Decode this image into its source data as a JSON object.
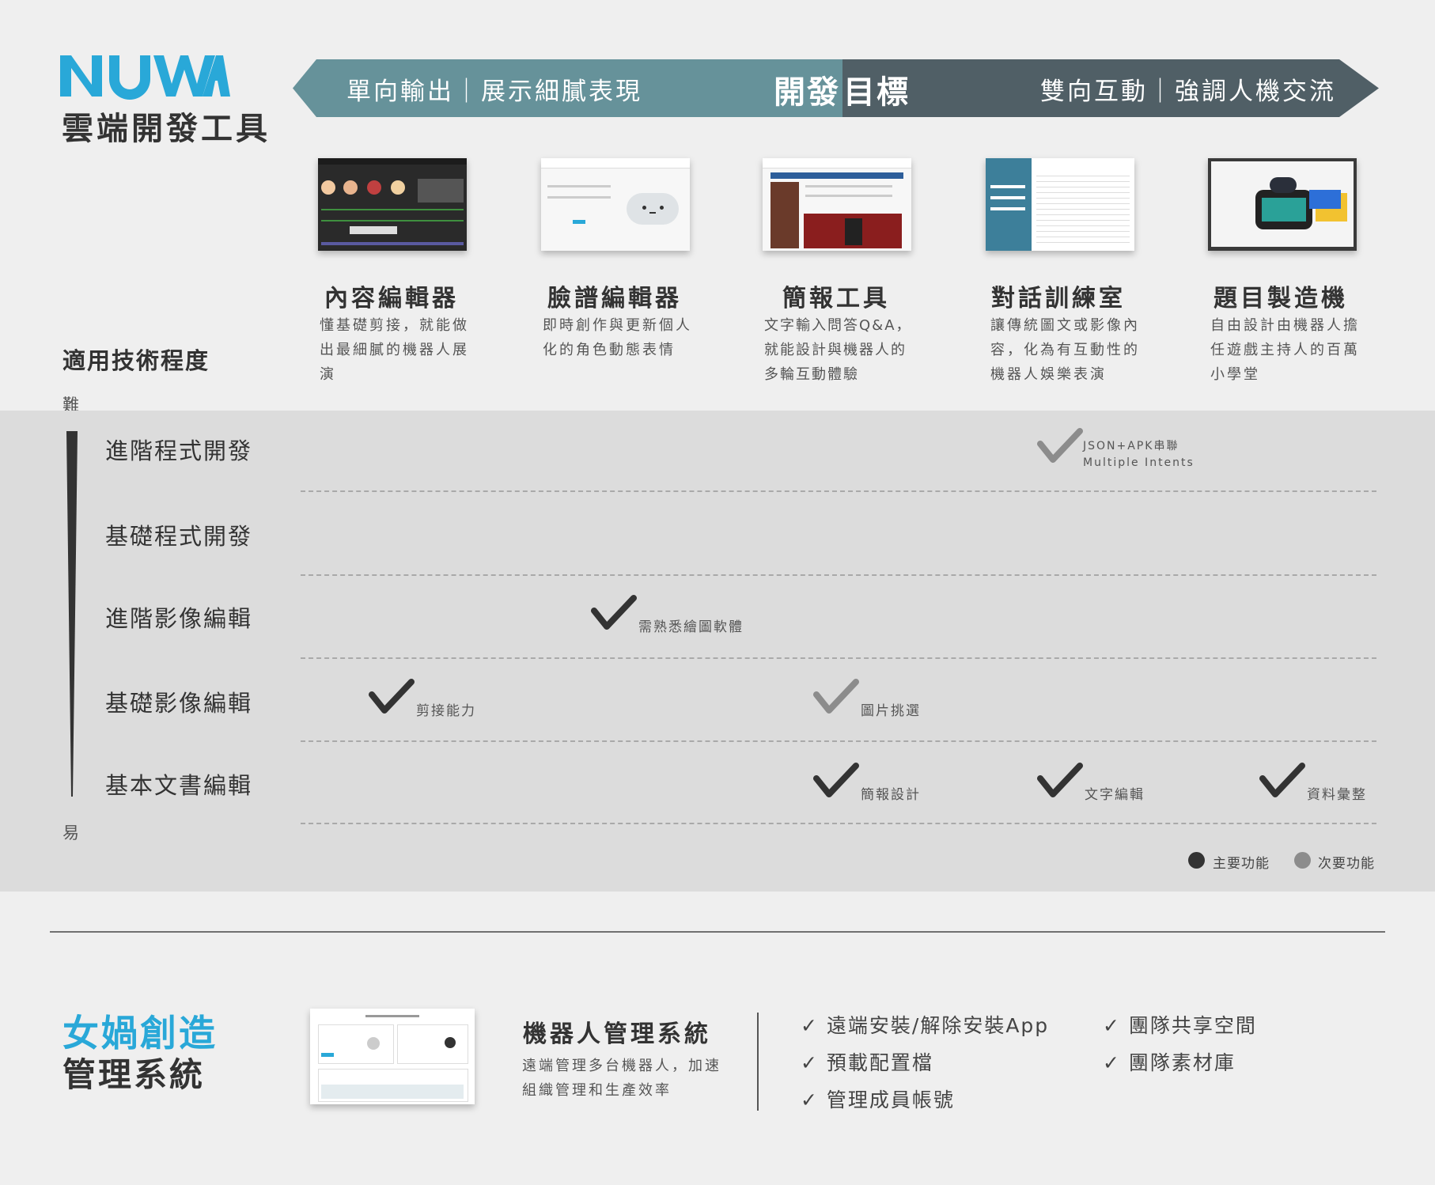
{
  "brand": {
    "logo": "NUWA",
    "subtitle": "雲端開發工具"
  },
  "goal_arrow": {
    "left_text": "單向輸出｜展示細膩表現",
    "center_left": "開發",
    "center_right": "目標",
    "right_text": "雙向互動｜強調人機交流"
  },
  "tools": [
    {
      "name": "內容編輯器",
      "desc": "懂基礎剪接，就能做出最細膩的機器人展演"
    },
    {
      "name": "臉譜編輯器",
      "desc": "即時創作與更新個人化的角色動態表情"
    },
    {
      "name": "簡報工具",
      "desc": "文字輸入問答Q&A，就能設計與機器人的多輪互動體驗"
    },
    {
      "name": "對話訓練室",
      "desc": "讓傳統圖文或影像內容，化為有互動性的機器人娛樂表演"
    },
    {
      "name": "題目製造機",
      "desc": "自由設計由機器人擔任遊戲主持人的百萬小學堂"
    }
  ],
  "level": {
    "title": "適用技術程度",
    "hard": "難",
    "easy": "易"
  },
  "rows": [
    "進階程式開發",
    "基礎程式開發",
    "進階影像編輯",
    "基礎影像編輯",
    "基本文書編輯"
  ],
  "marks": [
    {
      "row": 0,
      "tool": 3,
      "type": "secondary",
      "note_line1": "JSON+APK串聯",
      "note_line2": "Multiple Intents"
    },
    {
      "row": 2,
      "tool": 1,
      "type": "primary",
      "note": "需熟悉繪圖軟體"
    },
    {
      "row": 3,
      "tool": 0,
      "type": "primary",
      "note": "剪接能力"
    },
    {
      "row": 3,
      "tool": 2,
      "type": "secondary",
      "note": "圖片挑選"
    },
    {
      "row": 4,
      "tool": 2,
      "type": "primary",
      "note": "簡報設計"
    },
    {
      "row": 4,
      "tool": 3,
      "type": "primary",
      "note": "文字編輯"
    },
    {
      "row": 4,
      "tool": 4,
      "type": "primary",
      "note": "資料彙整"
    }
  ],
  "legend": {
    "primary": "主要功能",
    "secondary": "次要功能",
    "primary_color": "#333333",
    "secondary_color": "#8c8c8c"
  },
  "management": {
    "brand_line1": "女媧創造",
    "brand_line2": "管理系統",
    "title": "機器人管理系統",
    "desc": "遠端管理多台機器人，加速組織管理和生產效率",
    "features_col1": [
      "✓ 遠端安裝/解除安裝App",
      "✓ 預載配置檔",
      "✓ 管理成員帳號"
    ],
    "features_col2": [
      "✓ 團隊共享空間",
      "✓ 團隊素材庫"
    ]
  },
  "colors": {
    "arrow_left": "#66929a",
    "arrow_right": "#505f66",
    "accent_blue": "#29a8d8"
  }
}
